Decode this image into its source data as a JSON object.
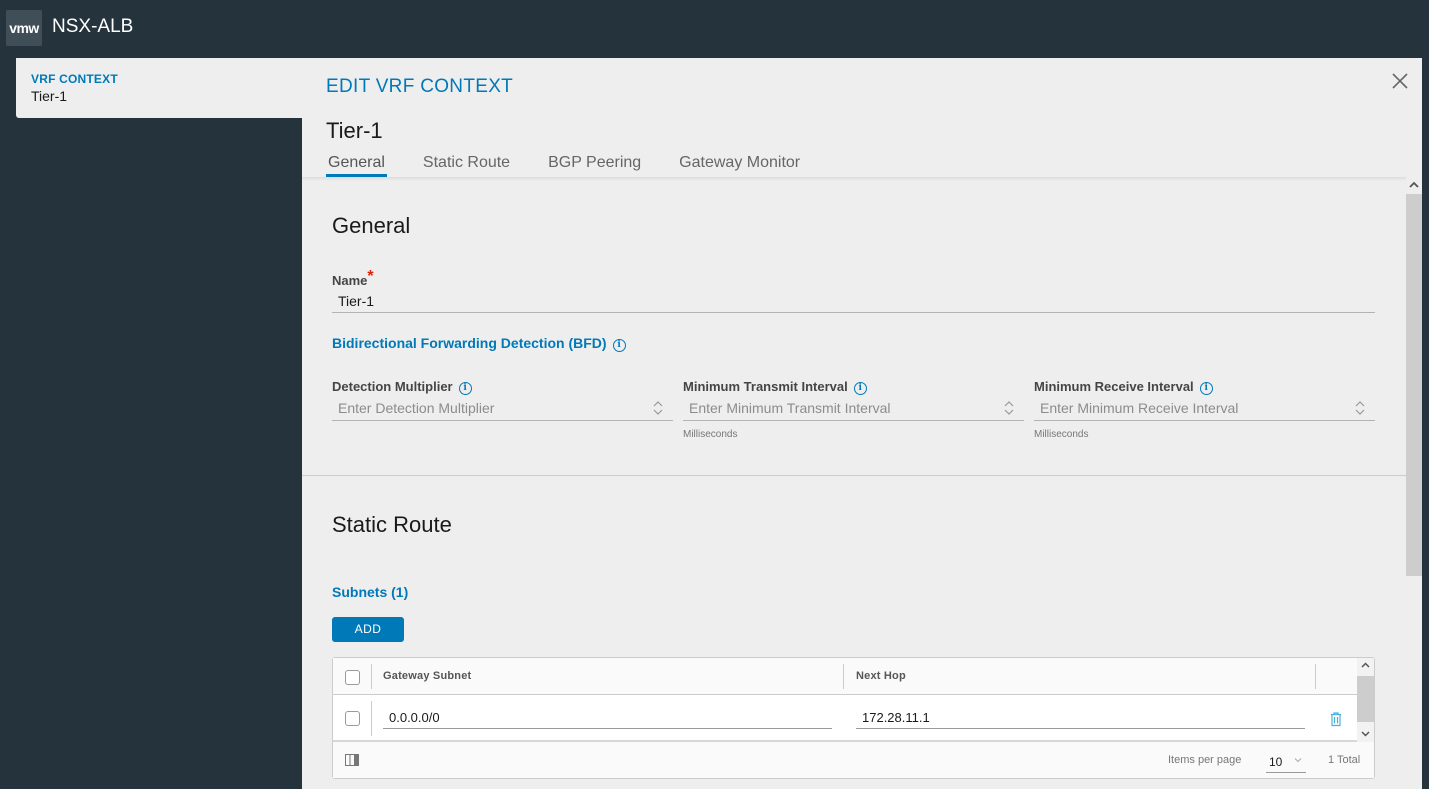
{
  "header": {
    "logo_text": "vmw",
    "app_title": "NSX-ALB"
  },
  "list_card": {
    "kicker": "VRF CONTEXT",
    "value": "Tier-1"
  },
  "modal": {
    "title": "EDIT VRF CONTEXT",
    "subtitle": "Tier-1",
    "close_icon": "close-icon",
    "tabs": [
      {
        "label": "General",
        "active": true
      },
      {
        "label": "Static Route",
        "active": false
      },
      {
        "label": "BGP Peering",
        "active": false
      },
      {
        "label": "Gateway Monitor",
        "active": false
      }
    ]
  },
  "general": {
    "title": "General",
    "name_label": "Name",
    "required_mark": "*",
    "name_value": "Tier-1",
    "bfd_heading": "Bidirectional Forwarding Detection (BFD)",
    "info_glyph": "i",
    "fields": [
      {
        "label": "Detection Multiplier",
        "placeholder": "Enter Detection Multiplier",
        "helper": ""
      },
      {
        "label": "Minimum Transmit Interval",
        "placeholder": "Enter Minimum Transmit Interval",
        "helper": "Milliseconds"
      },
      {
        "label": "Minimum Receive Interval",
        "placeholder": "Enter Minimum Receive Interval",
        "helper": "Milliseconds"
      }
    ]
  },
  "static_route": {
    "title": "Static Route",
    "subnets_heading": "Subnets (1)",
    "add_label": "ADD",
    "grid": {
      "columns": [
        "Gateway Subnet",
        "Next Hop"
      ],
      "rows": [
        {
          "gateway_subnet": "0.0.0.0/0",
          "next_hop": "172.28.11.1"
        }
      ],
      "items_per_page_label": "Items per page",
      "items_per_page_value": "10",
      "total": "1 Total"
    }
  },
  "colors": {
    "accent": "#0079b8",
    "header_bg": "#25333d",
    "panel_bg": "#eeeeee",
    "required": "#e12200"
  }
}
